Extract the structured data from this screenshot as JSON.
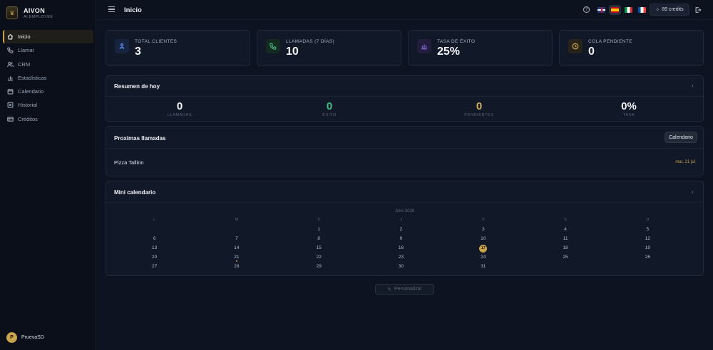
{
  "brand": {
    "name": "AIVON",
    "subtitle": "AI EMPLOYEE",
    "logo_icon": "crest-icon"
  },
  "sidebar": {
    "items": [
      {
        "label": "Inicio",
        "icon": "home-icon",
        "active": true
      },
      {
        "label": "Llamar",
        "icon": "phone-icon",
        "active": false
      },
      {
        "label": "CRM",
        "icon": "users-icon",
        "active": false
      },
      {
        "label": "Estadísticas",
        "icon": "bar-chart-icon",
        "active": false
      },
      {
        "label": "Calendario",
        "icon": "calendar-icon",
        "active": false
      },
      {
        "label": "Historial",
        "icon": "history-icon",
        "active": false
      },
      {
        "label": "Créditos",
        "icon": "credit-card-icon",
        "active": false
      }
    ],
    "user": {
      "initial": "P",
      "name": "PruevaSD"
    }
  },
  "header": {
    "title": "Inicio",
    "credits": "89 credits",
    "languages": [
      "en",
      "es",
      "it",
      "fr"
    ],
    "selected_language": "es"
  },
  "stats": [
    {
      "label": "TOTAL CLIENTES",
      "value": "3",
      "icon": "users-icon",
      "color": "#4f7fd9"
    },
    {
      "label": "LLAMADAS (7 DÍAS)",
      "value": "10",
      "icon": "phone-icon",
      "color": "#3fae7a"
    },
    {
      "label": "TASA DE ÉXITO",
      "value": "25%",
      "icon": "bar-chart-icon",
      "color": "#8a6be0"
    },
    {
      "label": "COLA PENDIENTE",
      "value": "0",
      "icon": "clock-icon",
      "color": "#c9a44a"
    }
  ],
  "summary": {
    "title": "Resumen de hoy",
    "items": [
      {
        "value": "0",
        "caption": "LLAMADAS",
        "color": "#f4f6fa"
      },
      {
        "value": "0",
        "caption": "ÉXITO",
        "color": "#3fc08a"
      },
      {
        "value": "0",
        "caption": "PENDIENTES",
        "color": "#d4b15a"
      },
      {
        "value": "0%",
        "caption": "TASA",
        "color": "#f4f6fa"
      }
    ]
  },
  "upcoming": {
    "title": "Proximas llamadas",
    "button": "Calendario",
    "calls": [
      {
        "name": "Pizza Tallinn",
        "date": "mar, 21 jul"
      }
    ]
  },
  "mini_calendar": {
    "title": "Mini calendario",
    "month": "Julio 2026",
    "weekdays": [
      "L",
      "M",
      "X",
      "J",
      "V",
      "S",
      "D"
    ],
    "weeks": [
      [
        "",
        "",
        "1",
        "2",
        "3",
        "4",
        "5"
      ],
      [
        "6",
        "7",
        "8",
        "9",
        "10",
        "11",
        "12"
      ],
      [
        "13",
        "14",
        "15",
        "16",
        "17",
        "18",
        "19"
      ],
      [
        "20",
        "21",
        "22",
        "23",
        "24",
        "25",
        "26"
      ],
      [
        "27",
        "28",
        "29",
        "30",
        "31",
        "",
        ""
      ]
    ],
    "today": "17",
    "event_days": [
      "21"
    ],
    "accent": "#c9a44a"
  },
  "customize": {
    "label": "Personalizar",
    "icon": "pencil-icon"
  }
}
